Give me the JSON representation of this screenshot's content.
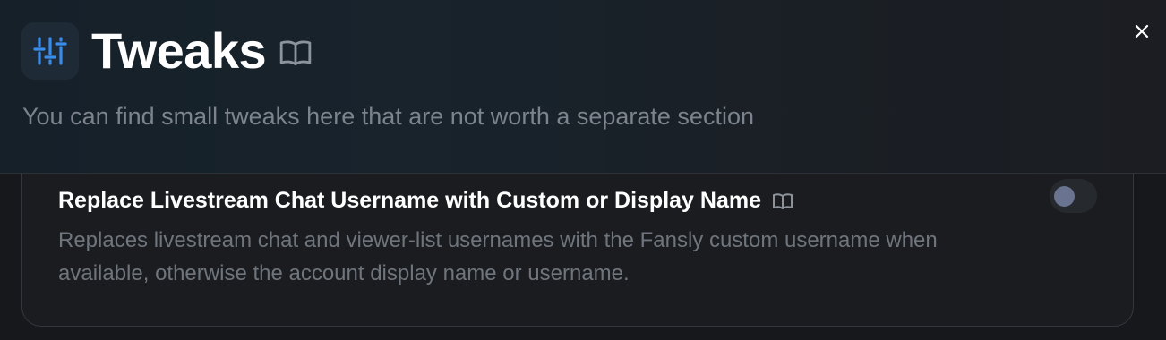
{
  "header": {
    "title": "Tweaks",
    "subtitle": "You can find small tweaks here that are not worth a separate section",
    "icon": "sliders-icon",
    "accent_color": "#3b8be8"
  },
  "setting": {
    "title": "Replace Livestream Chat Username with Custom or Display Name",
    "description": "Replaces livestream chat and viewer-list usernames with the Fansly custom username when available, otherwise the account display name or username.",
    "enabled": false
  },
  "colors": {
    "background": "#17181c",
    "title": "#ffffff",
    "muted_text": "#7c838c",
    "toggle_off_track": "#26292e",
    "toggle_off_knob": "#6a7490"
  }
}
